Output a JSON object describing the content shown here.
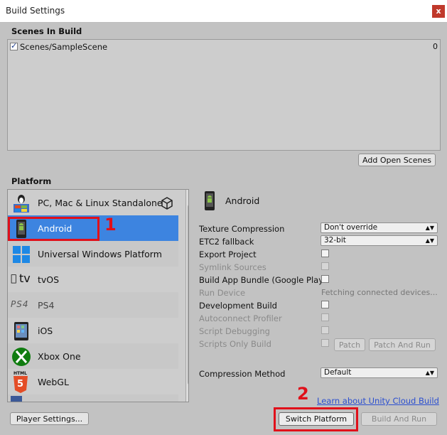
{
  "window": {
    "title": "Build Settings",
    "close_label": "x"
  },
  "scenes": {
    "header": "Scenes In Build",
    "items": [
      {
        "name": "Scenes/SampleScene",
        "index": "0",
        "checked": true
      }
    ],
    "add_open_scenes_label": "Add Open Scenes"
  },
  "platform": {
    "header": "Platform",
    "items": [
      {
        "label": "PC, Mac & Linux Standalone",
        "icon": "pc-mac-linux-icon"
      },
      {
        "label": "Android",
        "icon": "android-icon",
        "selected": true
      },
      {
        "label": "Universal Windows Platform",
        "icon": "windows-icon"
      },
      {
        "label": "tvOS",
        "icon": "apple-tv-icon"
      },
      {
        "label": "PS4",
        "icon": "ps4-icon"
      },
      {
        "label": "iOS",
        "icon": "ios-icon"
      },
      {
        "label": "Xbox One",
        "icon": "xbox-icon"
      },
      {
        "label": "WebGL",
        "icon": "html5-icon"
      }
    ],
    "ps4_logo_text": "PS4",
    "tv_logo_text": "tv",
    "html5_text": "HTML",
    "html5_num": "5",
    "current_label": "Android"
  },
  "settings": {
    "texture_compression": {
      "label": "Texture Compression",
      "value": "Don't override"
    },
    "etc2_fallback": {
      "label": "ETC2 fallback",
      "value": "32-bit"
    },
    "export_project": {
      "label": "Export Project"
    },
    "symlink_sources": {
      "label": "Symlink Sources"
    },
    "build_app_bundle": {
      "label": "Build App Bundle (Google Play"
    },
    "run_device": {
      "label": "Run Device",
      "value": "Fetching connected devices..."
    },
    "development_build": {
      "label": "Development Build"
    },
    "autoconnect_profiler": {
      "label": "Autoconnect Profiler"
    },
    "script_debugging": {
      "label": "Script Debugging"
    },
    "scripts_only_build": {
      "label": "Scripts Only Build",
      "patch_label": "Patch",
      "patch_and_run_label": "Patch And Run"
    },
    "compression_method": {
      "label": "Compression Method",
      "value": "Default"
    }
  },
  "footer": {
    "cloud_build_link": "Learn about Unity Cloud Build",
    "player_settings_label": "Player Settings...",
    "switch_platform_label": "Switch Platform",
    "build_and_run_label": "Build And Run"
  },
  "annotations": {
    "step1": "1",
    "step2": "2"
  },
  "colors": {
    "selected": "#3d84e0",
    "annotation": "#e0101a",
    "link": "#2b4fd0"
  }
}
